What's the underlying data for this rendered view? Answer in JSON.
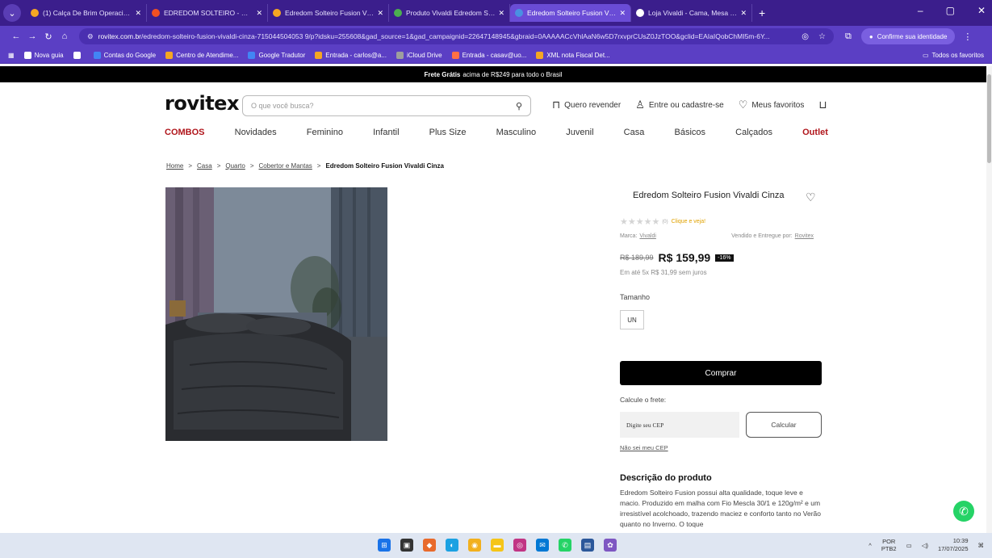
{
  "browser": {
    "tabs": [
      {
        "title": "(1) Calça De Brim Operacional |",
        "color": "#f5a623"
      },
      {
        "title": "EDREDOM SOLTEIRO - Google",
        "color": "#f25022"
      },
      {
        "title": "Edredom Solteiro Fusion Vivaldi",
        "color": "#f5a623"
      },
      {
        "title": "Produto Vivaldi Edredom Solte",
        "color": "#4caf50"
      },
      {
        "title": "Edredom Solteiro Fusion Vivaldi",
        "color": "#4a90e2"
      },
      {
        "title": "Loja Vivaldi - Cama, Mesa e Ba",
        "color": "#ffffff"
      }
    ],
    "url_host": "rovitex.com.br",
    "url_path": "/edredom-solteiro-fusion-vivaldi-cinza-715044504053 9/p?idsku=255608&gad_source=1&gad_campaignid=22647148945&gbraid=0AAAAACcVhlAaN6w5D7rxvprCUsZ0JzTOO&gclid=EAIaIQobChMI5m-6Y...",
    "identity_label": "Confirme sua identidade",
    "bookmarks": [
      {
        "label": "Nova guia",
        "color": "#ffffff"
      },
      {
        "label": "",
        "color": "#ffffff"
      },
      {
        "label": "Contas do Google",
        "color": "#4285f4"
      },
      {
        "label": "Centro de Atendime...",
        "color": "#f5a623"
      },
      {
        "label": "Google Tradutor",
        "color": "#4285f4"
      },
      {
        "label": "Entrada - carlos@a...",
        "color": "#f5a623"
      },
      {
        "label": "iCloud Drive",
        "color": "#9e9e9e"
      },
      {
        "label": "Entrada - casav@uo...",
        "color": "#ff7043"
      },
      {
        "label": "XML nota Fiscal Det...",
        "color": "#f5a623"
      }
    ],
    "all_bookmarks": "Todos os favoritos"
  },
  "promo": {
    "bold": "Frete Grátis",
    "rest": "acima de R$249 para todo o Brasil"
  },
  "header": {
    "logo": "rovitex",
    "search_placeholder": "O que você busca?",
    "resell": "Quero revender",
    "login": "Entre ou cadastre-se",
    "favorites": "Meus favoritos"
  },
  "nav": [
    "COMBOS",
    "Novidades",
    "Feminino",
    "Infantil",
    "Plus Size",
    "Masculino",
    "Juvenil",
    "Casa",
    "Básicos",
    "Calçados",
    "Outlet"
  ],
  "breadcrumb": {
    "items": [
      "Home",
      "Casa",
      "Quarto",
      "Cobertor e Mantas"
    ],
    "current": "Edredom Solteiro Fusion Vivaldi Cinza"
  },
  "product": {
    "title": "Edredom Solteiro Fusion Vivaldi Cinza",
    "rating_count": "(0)",
    "rating_cta": "Clique e veja!",
    "brand_label": "Marca:",
    "brand": "Vivaldi",
    "sold_label": "Vendido e Entregue por:",
    "seller": "Rovitex",
    "old_price": "R$ 189,99",
    "price": "R$ 159,99",
    "discount": "-16%",
    "installments": "Em até 5x R$ 31,99 sem juros",
    "size_label": "Tamanho",
    "size_option": "UN",
    "buy_label": "Comprar",
    "shipping_label": "Calcule o frete:",
    "cep_placeholder": "Digite seu CEP",
    "calc_label": "Calcular",
    "dunno_cep": "Não sei meu CEP",
    "desc_title": "Descrição do produto",
    "desc_text": "Edredom Solteiro Fusion possui alta qualidade, toque leve e macio. Produzido em malha com Fio Mescla 30/1 e 120g/m² e um irresistível acolchoado, trazendo maciez e conforto tanto no Verão quanto no Inverno. O toque"
  },
  "taskbar": {
    "lang_top": "POR",
    "lang_bottom": "PTB2",
    "time": "10:39",
    "date": "17/07/2025"
  }
}
